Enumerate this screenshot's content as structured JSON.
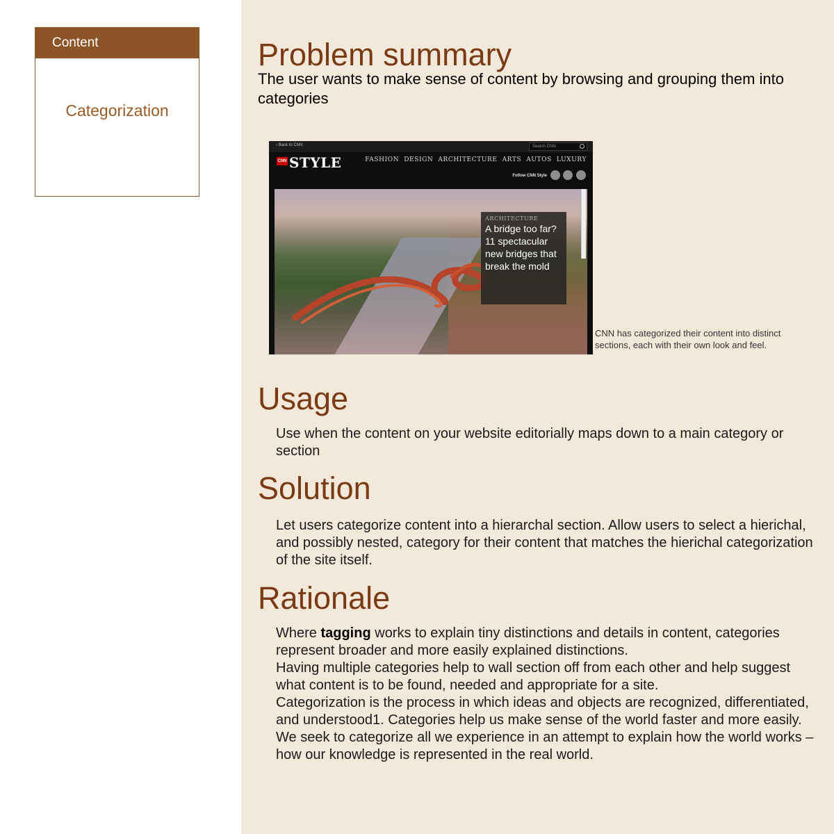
{
  "sidebar": {
    "header": "Content",
    "items": [
      {
        "label": "Categorization"
      }
    ]
  },
  "sections": {
    "problem": {
      "title": "Problem summary",
      "text": "The user wants to make sense of content by browsing and grouping them into categories"
    },
    "usage": {
      "title": "Usage",
      "text": "Use when the content on your website editorially maps down to a main category or section"
    },
    "solution": {
      "title": "Solution",
      "text": "Let users categorize content into a hierarchal section. Allow users to select a hierichal, and possibly nested, category for their content that matches the hierichal categorization of the site itself."
    },
    "rationale": {
      "title": "Rationale",
      "lead": "Where ",
      "bold": "tagging",
      "rest": " works to explain tiny distinctions and details in content, categories represent broader and more easily explained distinctions.",
      "p2": "Having multiple categories help to wall section off from each other and help suggest what content is to be found, needed and appropriate for a site.",
      "p3": "Categorization is the process in which ideas and objects are recognized, differentiated, and understood1. Categories help us make sense of the world faster and more easily. We seek to categorize all we experience in an attempt to explain how the world works – how our knowledge is represented in the real world."
    }
  },
  "screenshot": {
    "back": "Back to CNN",
    "search_placeholder": "Search CNN",
    "logo_cnn": "CNN",
    "logo_text": "STYLE",
    "nav": [
      "FASHION",
      "DESIGN",
      "ARCHITECTURE",
      "ARTS",
      "AUTOS",
      "LUXURY"
    ],
    "follow": "Follow CNN Style",
    "social": [
      "facebook-icon",
      "twitter-icon",
      "instagram-icon"
    ],
    "hero_category": "ARCHITECTURE",
    "hero_title": "A bridge too far? 11 spectacular new bridges that break the mold",
    "caption": "CNN has categorized their content into distinct sections, each with their own look and feel."
  },
  "colors": {
    "accent": "#8b5527",
    "heading": "#7a3a14",
    "main_bg": "#f3e9db",
    "cnn_red": "#cc0000"
  }
}
